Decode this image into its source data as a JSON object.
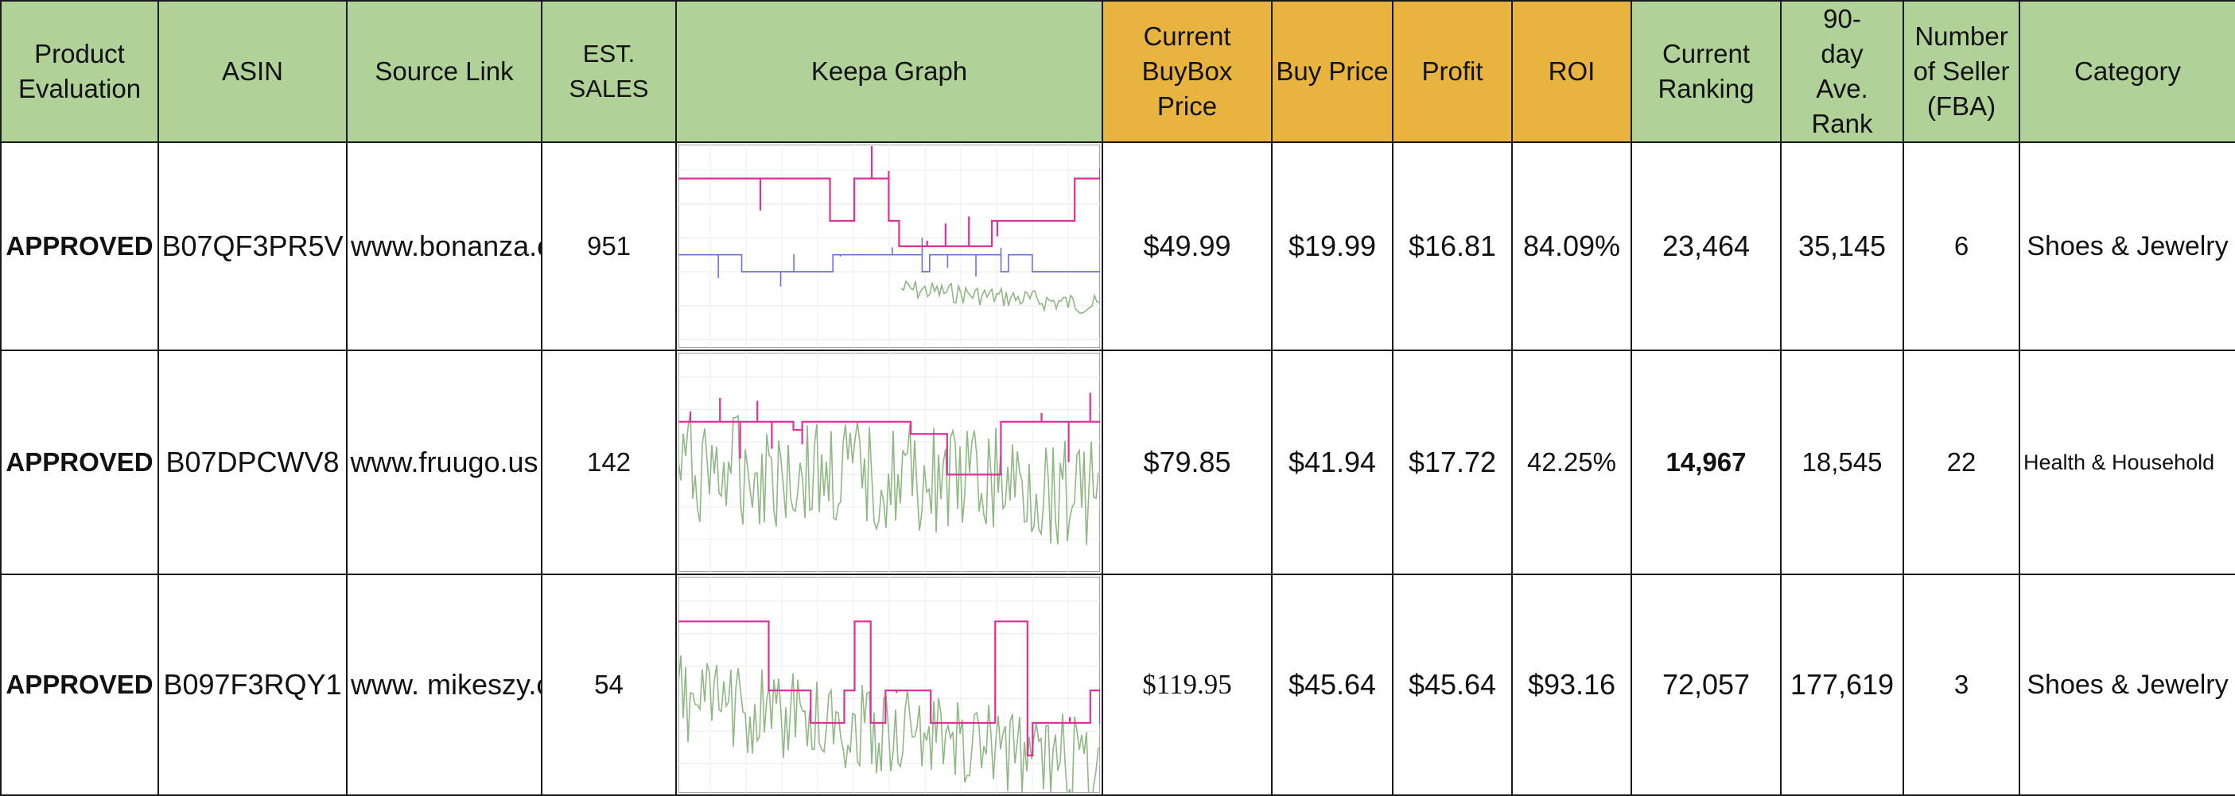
{
  "headers": {
    "evaluation": "Product Evaluation",
    "asin": "ASIN",
    "source": "Source Link",
    "sales": "EST. SALES",
    "graph": "Keepa Graph",
    "buybox": "Current BuyBox Price",
    "buy": "Buy Price",
    "profit": "Profit",
    "roi": "ROI",
    "ranking": "Current Ranking",
    "avg_rank": "90-day Ave. Rank",
    "sellers": "Number of Seller (FBA)",
    "category": "Category"
  },
  "colors": {
    "header_green": "#b0d197",
    "header_orange": "#e8b33e",
    "keepa_pink": "#e0309a",
    "keepa_green": "#8fb884",
    "keepa_blue": "#6d6fe0"
  },
  "rows": [
    {
      "evaluation": "APPROVED",
      "asin": "B07QF3PR5V",
      "source": "www.bonanza.c",
      "sales": "951",
      "buybox": "$49.99",
      "buy": "$19.99",
      "profit": "$16.81",
      "roi": "84.09%",
      "ranking": "23,464",
      "avg_rank": "35,145",
      "sellers": "6",
      "category": "Shoes & Jewelry"
    },
    {
      "evaluation": "APPROVED",
      "asin": "B07DPCWV8",
      "source": "www.fruugo.us",
      "sales": "142",
      "buybox": "$79.85",
      "buy": "$41.94",
      "profit": "$17.72",
      "roi": "42.25%",
      "ranking": "14,967",
      "avg_rank": "18,545",
      "sellers": "22",
      "category": "Health & Household"
    },
    {
      "evaluation": "APPROVED",
      "asin": "B097F3RQY1",
      "source": "www. mikeszy.c",
      "sales": "54",
      "buybox": "$119.95",
      "buy": "$45.64",
      "profit": "$45.64",
      "roi": "$93.16",
      "ranking": "72,057",
      "avg_rank": "177,619",
      "sellers": "3",
      "category": "Shoes & Jewelry"
    }
  ]
}
